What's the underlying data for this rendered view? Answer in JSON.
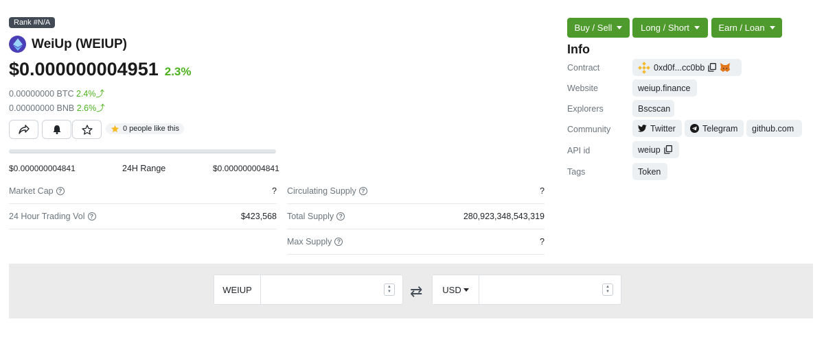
{
  "coin": {
    "rank": "Rank #N/A",
    "name": "WeiUp (WEIUP)",
    "price": "$0.000000004951",
    "change": "2.3%",
    "btc_price": "0.00000000 BTC",
    "btc_change": "2.4%",
    "bnb_price": "0.00000000 BNB",
    "bnb_change": "2.6%",
    "likes": "0 people like this"
  },
  "range": {
    "low": "$0.000000004841",
    "label": "24H Range",
    "high": "$0.000000004841"
  },
  "stats": {
    "market_cap_label": "Market Cap",
    "market_cap_value": "?",
    "volume_label": "24 Hour Trading Vol",
    "volume_value": "$423,568",
    "circulating_label": "Circulating Supply",
    "circulating_value": "?",
    "total_label": "Total Supply",
    "total_value": "280,923,348,543,319",
    "max_label": "Max Supply",
    "max_value": "?"
  },
  "actions": {
    "buy_sell": "Buy / Sell",
    "long_short": "Long / Short",
    "earn_loan": "Earn / Loan"
  },
  "info": {
    "heading": "Info",
    "contract_label": "Contract",
    "contract_value": "0xd0f...cc0bb",
    "website_label": "Website",
    "website_value": "weiup.finance",
    "explorers_label": "Explorers",
    "explorers_value": "Bscscan",
    "community_label": "Community",
    "twitter": "Twitter",
    "telegram": "Telegram",
    "github": "github.com",
    "api_label": "API id",
    "api_value": "weiup",
    "tags_label": "Tags",
    "tags_value": "Token"
  },
  "converter": {
    "from_currency": "WEIUP",
    "to_currency": "USD"
  },
  "colors": {
    "positive": "#4cb21e",
    "action_green": "#4e9a2d",
    "rank_badge": "#424b55"
  },
  "icons": [
    "share-icon",
    "bell-icon",
    "star-outline-icon",
    "star-icon",
    "arrow-up-icon",
    "caret-down-icon",
    "binance-icon",
    "copy-icon",
    "metamask-icon",
    "twitter-icon",
    "telegram-icon",
    "swap-icon"
  ]
}
